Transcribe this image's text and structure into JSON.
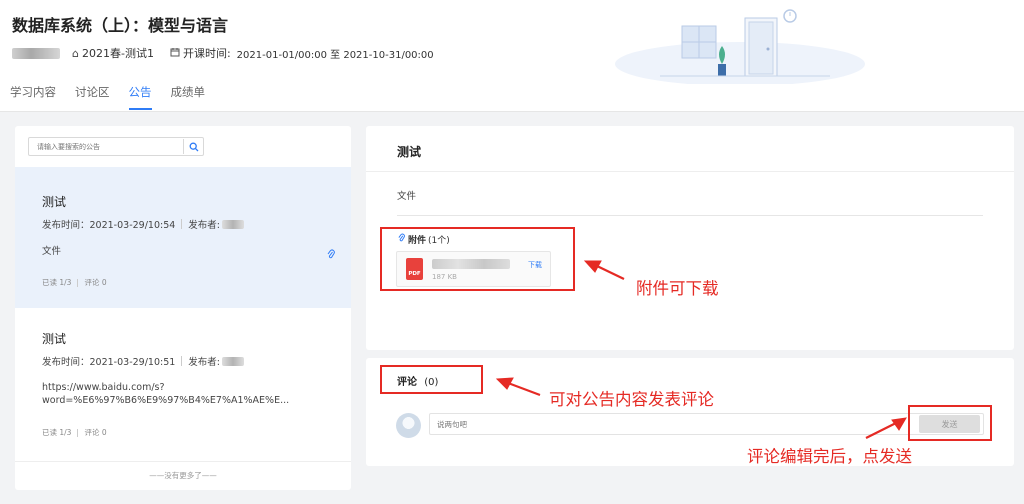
{
  "header": {
    "course_title": "数据库系统（上）：模型与语言",
    "term": "2021春-测试1",
    "time_label": "开课时间:",
    "time_range": "2021-01-01/00:00 至 2021-10-31/00:00",
    "home_icon": "home-icon",
    "calendar_icon": "calendar-icon"
  },
  "tabs": [
    {
      "label": "学习内容",
      "active": false
    },
    {
      "label": "讨论区",
      "active": false
    },
    {
      "label": "公告",
      "active": true
    },
    {
      "label": "成绩单",
      "active": false
    }
  ],
  "search": {
    "placeholder": "请输入要搜索的公告",
    "icon": "search-icon"
  },
  "announcements": [
    {
      "title": "测试",
      "publish_time": "发布时间：2021-03-29/10:54",
      "publisher_label": "发布者:",
      "body": "文件",
      "body_line2": "",
      "stats_read": "已读 1/3",
      "stats_comments": "评论 0",
      "has_attachment": true,
      "selected": true
    },
    {
      "title": "测试",
      "publish_time": "发布时间：2021-03-29/10:51",
      "publisher_label": "发布者:",
      "body": "https://www.baidu.com/s?",
      "body_line2": "word=%E6%97%B6%E9%97%B4%E7%A1%AE%E...",
      "stats_read": "已读 1/3",
      "stats_comments": "评论 0",
      "has_attachment": false,
      "selected": false
    }
  ],
  "list_end_text": "——没有更多了——",
  "detail": {
    "title": "测试",
    "body": "文件",
    "attachment_label": "附件",
    "attachment_count": "(1个)",
    "file_type": "PDF",
    "file_size": "187 KB",
    "download_label": "下载"
  },
  "comments": {
    "title": "评论",
    "count": "(0)",
    "placeholder": "说两句吧",
    "send_label": "发送"
  },
  "annotations": {
    "download_note": "附件可下载",
    "comment_note": "可对公告内容发表评论",
    "send_note": "评论编辑完后，点发送",
    "color": "#e52a24"
  },
  "colors": {
    "accent": "#2f7cf6",
    "selected_bg": "#eaf1fb",
    "page_bg": "#f2f3f5"
  }
}
